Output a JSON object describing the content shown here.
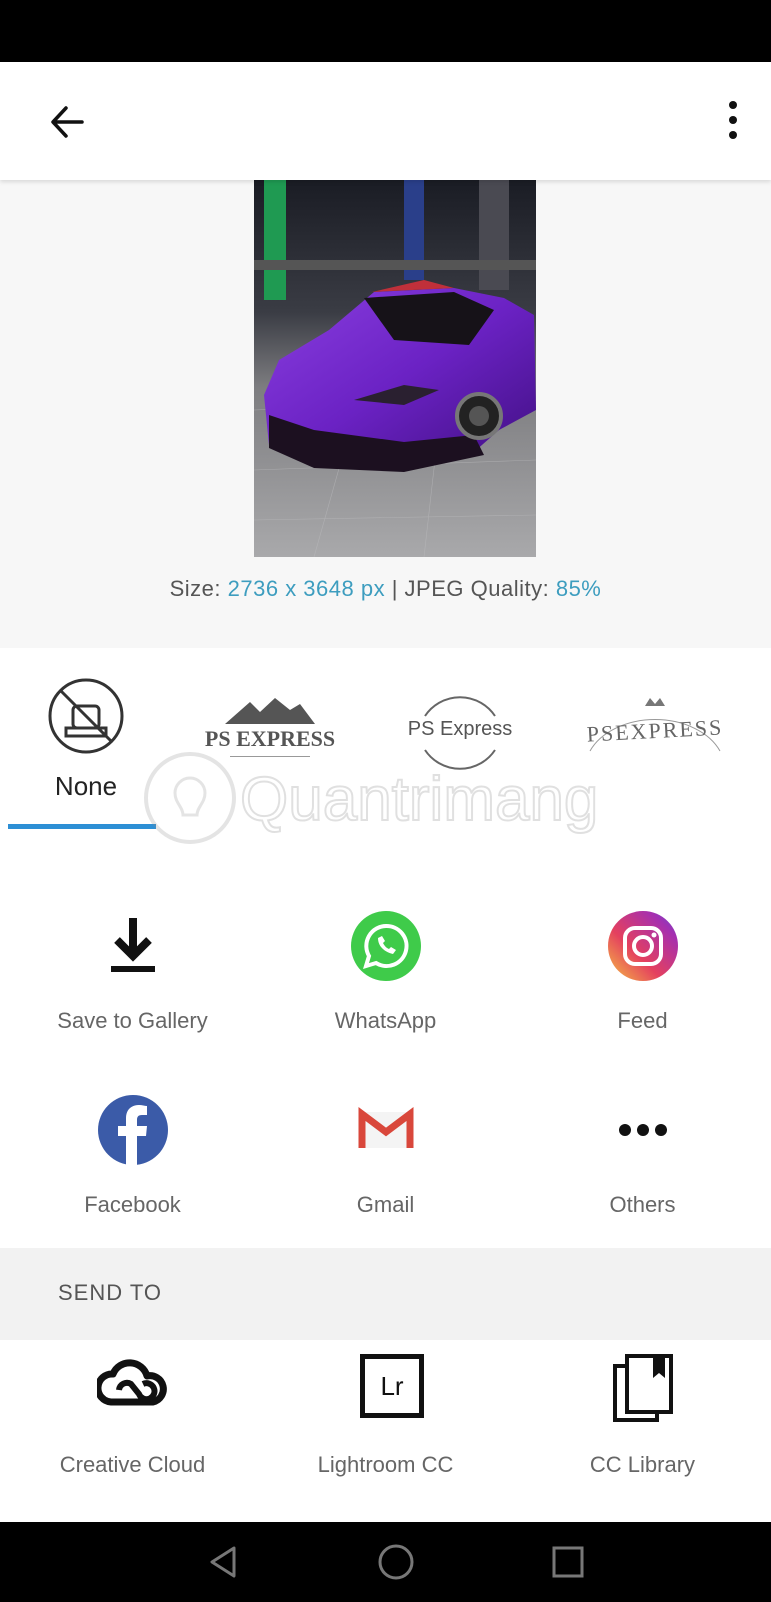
{
  "photo": {
    "size_prefix": "Size: ",
    "size_value": "2736 x 3648 px",
    "separator": " | JPEG Quality: ",
    "quality_value": "85%"
  },
  "watermarks": {
    "selected": "None",
    "none_label": "None",
    "options": [
      {
        "name": "ps-express-mountain",
        "text": "PS EXPRESS"
      },
      {
        "name": "ps-express-circle",
        "text": "PS Express"
      },
      {
        "name": "ps-express-arc",
        "text": "PSEXPRESS"
      }
    ],
    "overlay_text": "Quantrimang"
  },
  "share": {
    "items": [
      {
        "label": "Save to Gallery",
        "icon": "download-icon"
      },
      {
        "label": "WhatsApp",
        "icon": "whatsapp-icon"
      },
      {
        "label": "Feed",
        "icon": "instagram-icon"
      },
      {
        "label": "Facebook",
        "icon": "facebook-icon"
      },
      {
        "label": "Gmail",
        "icon": "gmail-icon"
      },
      {
        "label": "Others",
        "icon": "more-horizontal-icon"
      }
    ]
  },
  "send_to": {
    "title": "SEND TO",
    "items": [
      {
        "label": "Creative Cloud",
        "icon": "creative-cloud-icon"
      },
      {
        "label": "Lightroom CC",
        "icon": "lightroom-icon",
        "icon_text": "Lr"
      },
      {
        "label": "CC Library",
        "icon": "cc-library-icon"
      }
    ]
  },
  "colors": {
    "accent": "#3d9dbf",
    "tab_indicator": "#2d8fd5",
    "whatsapp": "#3fcb4a",
    "facebook": "#3b5ba8",
    "gmail": "#d9473b"
  }
}
